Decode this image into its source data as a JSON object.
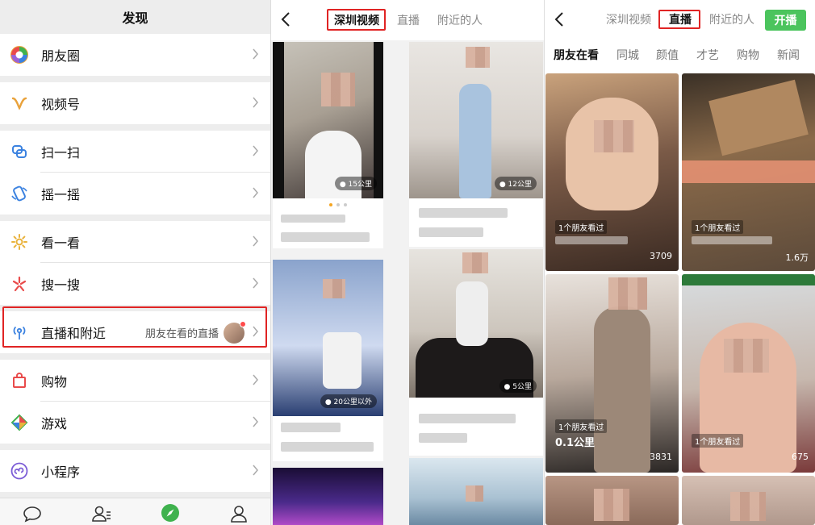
{
  "discover": {
    "title": "发现",
    "items": [
      {
        "label": "朋友圈"
      },
      {
        "label": "视频号"
      },
      {
        "label": "扫一扫"
      },
      {
        "label": "摇一摇"
      },
      {
        "label": "看一看"
      },
      {
        "label": "搜一搜"
      },
      {
        "label": "直播和附近",
        "sub": "朋友在看的直播"
      },
      {
        "label": "购物"
      },
      {
        "label": "游戏"
      },
      {
        "label": "小程序"
      }
    ]
  },
  "nearby": {
    "tabs": [
      "深圳视频",
      "直播",
      "附近的人"
    ],
    "distances": [
      "15公里",
      "12公里",
      "20公里以外",
      "5公里"
    ]
  },
  "live": {
    "tabs": [
      "深圳视频",
      "直播",
      "附近的人"
    ],
    "start_button": "开播",
    "categories": [
      "朋友在看",
      "同城",
      "颜值",
      "才艺",
      "购物",
      "新闻"
    ],
    "cards": [
      {
        "friend": "1个朋友看过",
        "count": "3709"
      },
      {
        "friend": "1个朋友看过",
        "count": "1.6万"
      },
      {
        "friend": "1个朋友看过",
        "distance": "0.1公里",
        "count": "3831"
      },
      {
        "friend": "1个朋友看过",
        "count": "675"
      }
    ]
  },
  "colors": {
    "accent": "#4bc45d",
    "highlight": "#e02424"
  }
}
